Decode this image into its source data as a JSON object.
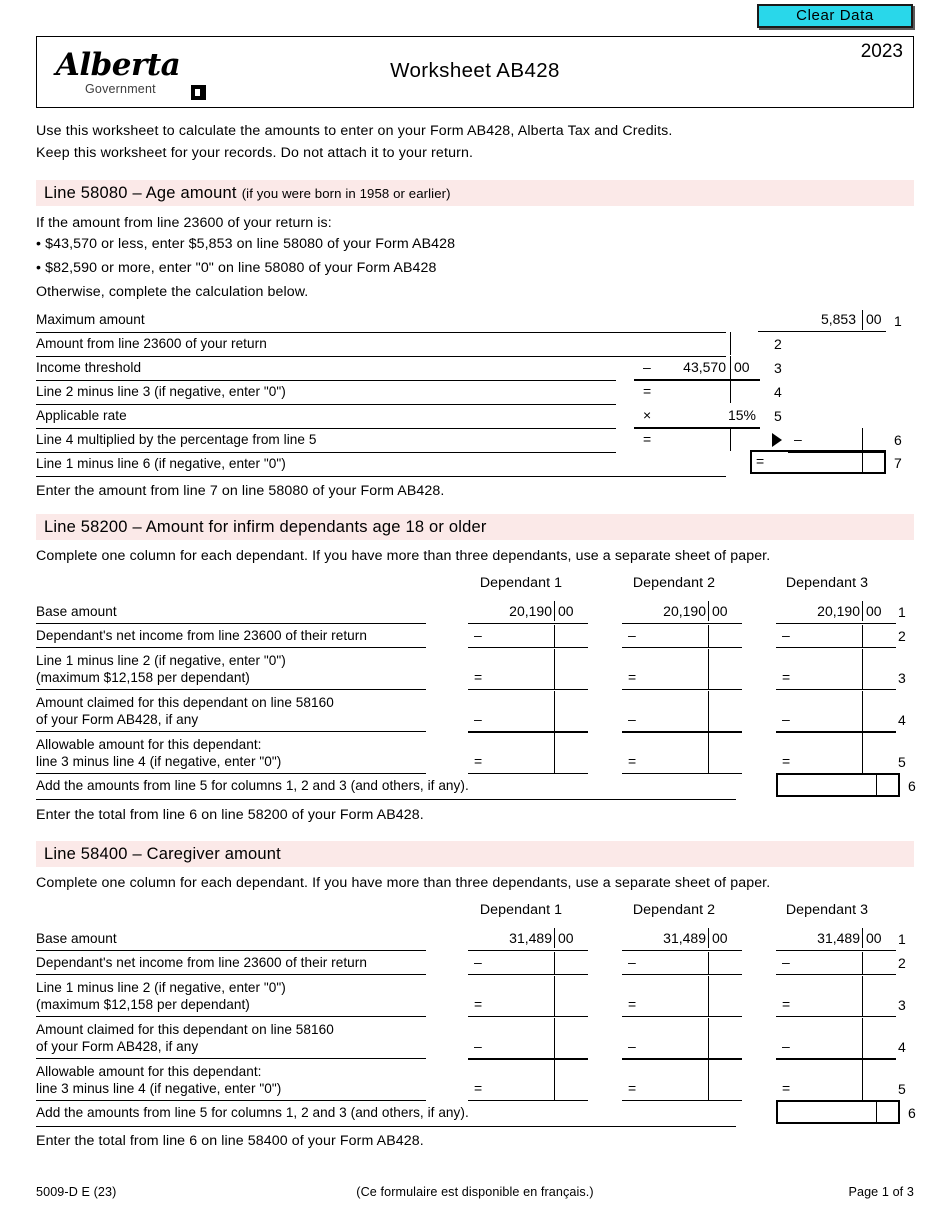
{
  "toolbar": {
    "clear_data_label": "Clear Data",
    "accent_color": "#29d7ea"
  },
  "header": {
    "logo_word": "Alberta",
    "logo_sub": "Government",
    "title": "Worksheet AB428",
    "year": "2023"
  },
  "intro": {
    "line1": "Use this worksheet to calculate the amounts to enter on your Form AB428, Alberta Tax and Credits.",
    "line2": "Keep this worksheet for your records. Do not attach it to your return."
  },
  "section_color": "#fbe9e8",
  "section_age": {
    "title": "Line 58080 – Age amount",
    "note": "(if you were born in 1958 or earlier)",
    "intro": "If the amount from line 23600 of your return is:",
    "bullet1": "• $43,570 or less, enter $5,853 on line 58080 of your Form AB428",
    "bullet2": "• $82,590 or more, enter \"0\" on line 58080 of your Form AB428",
    "otherwise": "Otherwise, complete the calculation below.",
    "rows": [
      {
        "no": "1",
        "label": "Maximum amount",
        "op": "",
        "amount": "5,853",
        "cents": "00"
      },
      {
        "no": "2",
        "label": "Amount from line 23600 of your return",
        "op": "",
        "amount": "",
        "cents": ""
      },
      {
        "no": "3",
        "label": "Income threshold",
        "op": "–",
        "amount": "43,570",
        "cents": "00"
      },
      {
        "no": "4",
        "label": "Line 2 minus line 3 (if negative, enter \"0\")",
        "op": "=",
        "amount": "",
        "cents": ""
      },
      {
        "no": "5",
        "label": "Applicable rate",
        "op": "×",
        "amount": "15%",
        "cents": ""
      },
      {
        "no": "6",
        "label": "Line 4 multiplied by the percentage from line 5",
        "op": "=",
        "amount": "",
        "cents": "",
        "op2": "–"
      },
      {
        "no": "7",
        "label": "Line 1 minus line 6 (if negative, enter \"0\")",
        "op": "=",
        "amount": "",
        "cents": ""
      }
    ],
    "closing": "Enter the amount from line 7 on line 58080 of your Form AB428."
  },
  "section_infirm": {
    "title": "Line 58200 – Amount for infirm dependants age 18 or older",
    "intro": "Complete one column for each dependant. If you have more than three dependants, use a separate sheet of paper.",
    "columns": [
      "Dependant 1",
      "Dependant 2",
      "Dependant 3"
    ],
    "rows": [
      {
        "no": "1",
        "label": "Base amount",
        "op": "",
        "amount": "20,190",
        "cents": "00"
      },
      {
        "no": "2",
        "label": "Dependant's net income from line 23600 of their return",
        "op": "–",
        "amount": "",
        "cents": ""
      },
      {
        "no": "3",
        "label": "Line 1 minus line 2 (if negative, enter \"0\")\n(maximum $12,158 per dependant)",
        "op": "=",
        "amount": "",
        "cents": ""
      },
      {
        "no": "4",
        "label": "Amount claimed for this dependant on line 58160\nof your Form AB428, if any",
        "op": "–",
        "amount": "",
        "cents": ""
      },
      {
        "no": "5",
        "label": "Allowable amount for this dependant:\nline 3 minus line 4 (if negative, enter \"0\")",
        "op": "=",
        "amount": "",
        "cents": ""
      }
    ],
    "total_row": {
      "no": "6",
      "label": "Add the amounts from line 5 for columns 1, 2 and 3 (and others, if any)."
    },
    "closing": "Enter the total from line 6 on line 58200 of your Form AB428."
  },
  "section_caregiver": {
    "title": "Line 58400 – Caregiver amount",
    "intro": "Complete one column for each dependant. If you have more than three dependants, use a separate sheet of paper.",
    "columns": [
      "Dependant 1",
      "Dependant 2",
      "Dependant 3"
    ],
    "rows": [
      {
        "no": "1",
        "label": "Base amount",
        "op": "",
        "amount": "31,489",
        "cents": "00"
      },
      {
        "no": "2",
        "label": "Dependant's net income from line 23600 of their return",
        "op": "–",
        "amount": "",
        "cents": ""
      },
      {
        "no": "3",
        "label": "Line 1 minus line 2 (if negative, enter \"0\")\n(maximum $12,158 per dependant)",
        "op": "=",
        "amount": "",
        "cents": ""
      },
      {
        "no": "4",
        "label": "Amount claimed for this dependant on line 58160\nof your Form AB428, if any",
        "op": "–",
        "amount": "",
        "cents": ""
      },
      {
        "no": "5",
        "label": "Allowable amount for this dependant:\nline 3 minus line 4 (if negative, enter \"0\")",
        "op": "=",
        "amount": "",
        "cents": ""
      }
    ],
    "total_row": {
      "no": "6",
      "label": "Add the amounts from line 5 for columns 1, 2 and 3 (and others, if any)."
    },
    "closing": "Enter the total from line 6 on line 58400 of your Form AB428."
  },
  "footer": {
    "form_code": "5009-D E (23)",
    "french_note": "(Ce formulaire est disponible en français.)",
    "page": "Page 1 of 3"
  }
}
